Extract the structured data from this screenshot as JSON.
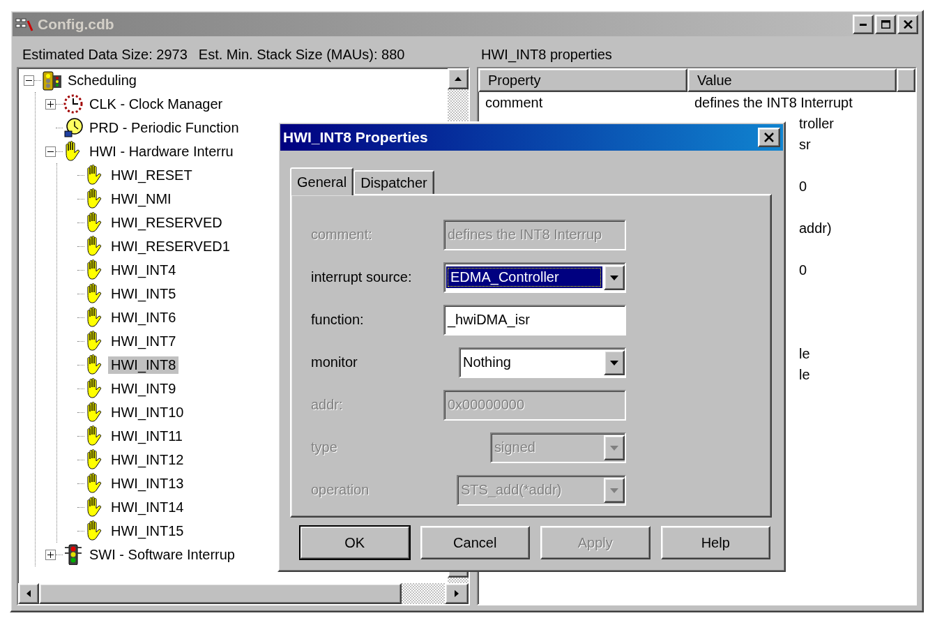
{
  "window": {
    "title": "Config.cdb"
  },
  "status": [
    "Estimated Data Size: 2973",
    "Est. Min. Stack Size (MAUs): 880"
  ],
  "tree": [
    {
      "label": "Scheduling",
      "kind": "scheduler",
      "expanded": true,
      "selected": false,
      "children": [
        {
          "label": "CLK - Clock Manager",
          "kind": "clock",
          "expanded": false,
          "selected": false
        },
        {
          "label": "PRD - Periodic Function",
          "kind": "periodic",
          "selected": false
        },
        {
          "label": "HWI - Hardware Interru",
          "kind": "hand",
          "expanded": true,
          "selected": false,
          "children": [
            {
              "label": "HWI_RESET",
              "kind": "hand",
              "selected": false
            },
            {
              "label": "HWI_NMI",
              "kind": "hand",
              "selected": false
            },
            {
              "label": "HWI_RESERVED",
              "kind": "hand",
              "selected": false
            },
            {
              "label": "HWI_RESERVED1",
              "kind": "hand",
              "selected": false
            },
            {
              "label": "HWI_INT4",
              "kind": "hand",
              "selected": false
            },
            {
              "label": "HWI_INT5",
              "kind": "hand",
              "selected": false
            },
            {
              "label": "HWI_INT6",
              "kind": "hand",
              "selected": false
            },
            {
              "label": "HWI_INT7",
              "kind": "hand",
              "selected": false
            },
            {
              "label": "HWI_INT8",
              "kind": "hand",
              "selected": true
            },
            {
              "label": "HWI_INT9",
              "kind": "hand",
              "selected": false
            },
            {
              "label": "HWI_INT10",
              "kind": "hand",
              "selected": false
            },
            {
              "label": "HWI_INT11",
              "kind": "hand",
              "selected": false
            },
            {
              "label": "HWI_INT12",
              "kind": "hand",
              "selected": false
            },
            {
              "label": "HWI_INT13",
              "kind": "hand",
              "selected": false
            },
            {
              "label": "HWI_INT14",
              "kind": "hand",
              "selected": false
            },
            {
              "label": "HWI_INT15",
              "kind": "hand",
              "selected": false
            }
          ]
        },
        {
          "label": "SWI - Software Interrup",
          "kind": "traffic-light",
          "expanded": false,
          "selected": false
        }
      ]
    }
  ],
  "properties": {
    "title": "HWI_INT8 properties",
    "columns": [
      "Property",
      "Value"
    ],
    "rows": [
      {
        "property": "comment",
        "value": "defines the INT8 Interrupt"
      },
      {
        "value": "troller"
      },
      {
        "value": "sr"
      },
      {},
      {
        "value": "0"
      },
      {},
      {
        "value": "addr)"
      },
      {},
      {
        "value": "0"
      },
      {},
      {},
      {},
      {
        "value": "le"
      },
      {
        "value": "le"
      }
    ]
  },
  "dialog": {
    "title": "HWI_INT8 Properties",
    "tabs": [
      {
        "label": "General",
        "selected": true
      },
      {
        "label": "Dispatcher",
        "selected": false
      }
    ],
    "fields": [
      {
        "label": "comment:",
        "kind": "text",
        "value": "defines the INT8 Interrup",
        "disabled": true,
        "focused": false
      },
      {
        "label": "interrupt source:",
        "kind": "combo",
        "value": "EDMA_Controller",
        "disabled": false,
        "focused": true
      },
      {
        "label": "function:",
        "kind": "text",
        "value": "_hwiDMA_isr",
        "disabled": false,
        "focused": false
      },
      {
        "label": "monitor",
        "kind": "combo",
        "value": "Nothing",
        "disabled": false,
        "focused": false
      },
      {
        "label": "addr:",
        "kind": "text",
        "value": "0x00000000",
        "disabled": true,
        "focused": false
      },
      {
        "label": "type",
        "kind": "combo",
        "value": "signed",
        "disabled": true,
        "focused": false
      },
      {
        "label": "operation",
        "kind": "combo",
        "value": "STS_add(*addr)",
        "disabled": true,
        "focused": false
      }
    ],
    "buttons": [
      {
        "label": "OK",
        "default": true,
        "disabled": false
      },
      {
        "label": "Cancel",
        "default": false,
        "disabled": false
      },
      {
        "label": "Apply",
        "default": false,
        "disabled": true
      },
      {
        "label": "Help",
        "default": false,
        "disabled": false
      }
    ]
  }
}
